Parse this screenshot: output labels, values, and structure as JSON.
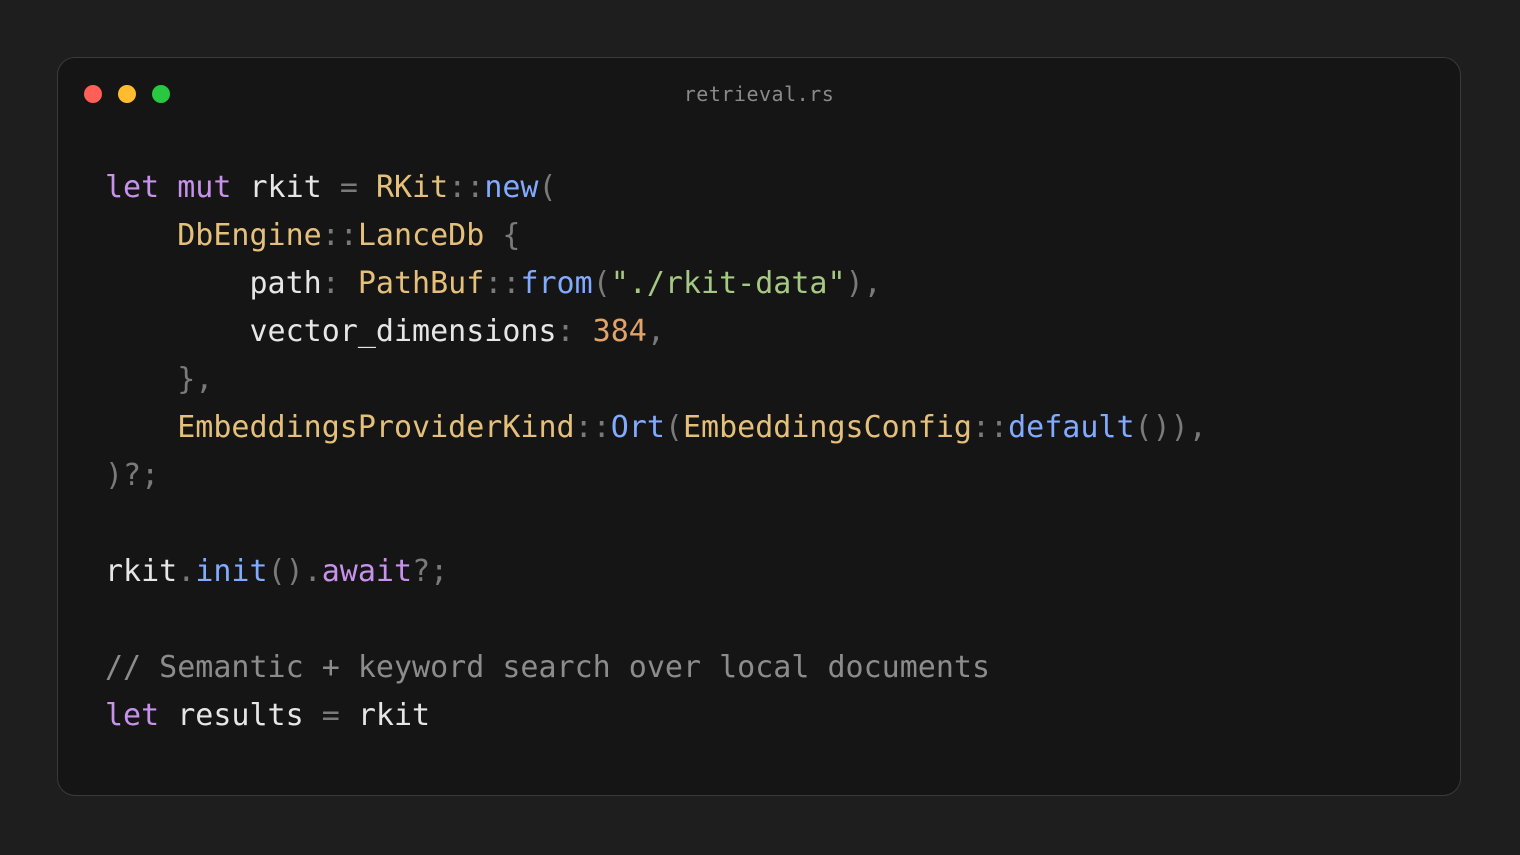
{
  "window": {
    "title": "retrieval.rs"
  },
  "traffic_lights": {
    "close_color": "#ff5f57",
    "minimize_color": "#febc2e",
    "zoom_color": "#28c840"
  },
  "syntax_colors": {
    "keyword": "#c792ea",
    "type": "#e5c07b",
    "function": "#82aaff",
    "string": "#a5c882",
    "number": "#e0a36b",
    "punct": "#7a7a7a",
    "ident": "#e6e6e6",
    "comment": "#8c8c8c"
  },
  "code_lines": [
    [
      [
        "keyword",
        "let"
      ],
      [
        "ident",
        " "
      ],
      [
        "keyword",
        "mut"
      ],
      [
        "ident",
        " rkit "
      ],
      [
        "punct",
        "="
      ],
      [
        "ident",
        " "
      ],
      [
        "type",
        "RKit"
      ],
      [
        "punct",
        "::"
      ],
      [
        "function",
        "new"
      ],
      [
        "punct",
        "("
      ]
    ],
    [
      [
        "ident",
        "    "
      ],
      [
        "type",
        "DbEngine"
      ],
      [
        "punct",
        "::"
      ],
      [
        "type",
        "LanceDb"
      ],
      [
        "ident",
        " "
      ],
      [
        "punct",
        "{"
      ]
    ],
    [
      [
        "ident",
        "        path"
      ],
      [
        "punct",
        ":"
      ],
      [
        "ident",
        " "
      ],
      [
        "type",
        "PathBuf"
      ],
      [
        "punct",
        "::"
      ],
      [
        "function",
        "from"
      ],
      [
        "punct",
        "("
      ],
      [
        "string",
        "\"./rkit-data\""
      ],
      [
        "punct",
        "),"
      ]
    ],
    [
      [
        "ident",
        "        vector_dimensions"
      ],
      [
        "punct",
        ":"
      ],
      [
        "ident",
        " "
      ],
      [
        "number",
        "384"
      ],
      [
        "punct",
        ","
      ]
    ],
    [
      [
        "ident",
        "    "
      ],
      [
        "punct",
        "},"
      ]
    ],
    [
      [
        "ident",
        "    "
      ],
      [
        "type",
        "EmbeddingsProviderKind"
      ],
      [
        "punct",
        "::"
      ],
      [
        "function",
        "Ort"
      ],
      [
        "punct",
        "("
      ],
      [
        "type",
        "EmbeddingsConfig"
      ],
      [
        "punct",
        "::"
      ],
      [
        "function",
        "default"
      ],
      [
        "punct",
        "()),"
      ]
    ],
    [
      [
        "punct",
        ")?;"
      ]
    ],
    [],
    [
      [
        "ident",
        "rkit"
      ],
      [
        "punct",
        "."
      ],
      [
        "function",
        "init"
      ],
      [
        "punct",
        "()."
      ],
      [
        "keyword",
        "await"
      ],
      [
        "punct",
        "?;"
      ]
    ],
    [],
    [
      [
        "comment",
        "// Semantic + keyword search over local documents"
      ]
    ],
    [
      [
        "keyword",
        "let"
      ],
      [
        "ident",
        " results "
      ],
      [
        "punct",
        "="
      ],
      [
        "ident",
        " rkit"
      ]
    ]
  ]
}
